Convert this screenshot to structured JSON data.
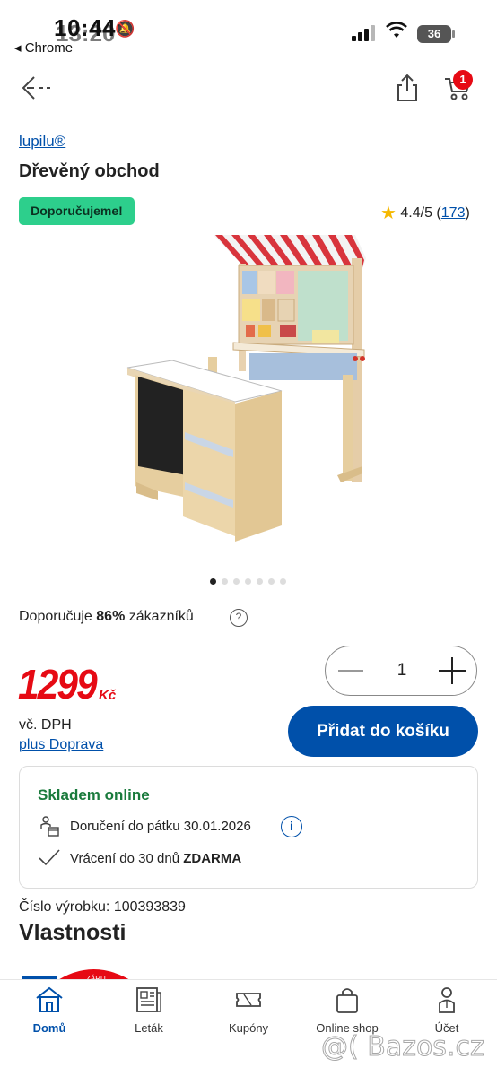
{
  "status_bar": {
    "time": "10:44",
    "time_overlay": "13:20",
    "back_app": "◂ Chrome",
    "battery": "36"
  },
  "header": {
    "cart_count": "1",
    "icons": [
      "back-arrow-icon",
      "share-icon",
      "cart-icon"
    ]
  },
  "product": {
    "brand": "lupilu®",
    "title": "Dřevěný obchod",
    "badge": "Doporučujeme!",
    "rating": "4.4/5",
    "rating_count": "173",
    "gallery_total": 7,
    "gallery_active": 1,
    "recommend_prefix": "Doporučuje",
    "recommend_percent": "86%",
    "recommend_suffix": "zákazníků",
    "quantity": "1",
    "price": "1299",
    "currency": "Kč",
    "vat": "vč. DPH",
    "shipping_link": "plus Doprava",
    "add_to_cart": "Přidat do košíku",
    "sku": "Číslo výrobku: 100393839",
    "section_title": "Vlastnosti"
  },
  "stock": {
    "title": "Skladem online",
    "delivery": "Doručení do pátku 30.01.2026",
    "return_prefix": "Vrácení do 30 dnů",
    "return_bold": "ZDARMA"
  },
  "bottom_nav": [
    {
      "label": "Domů",
      "icon": "home-icon",
      "active": true
    },
    {
      "label": "Leták",
      "icon": "leaflet-icon",
      "active": false
    },
    {
      "label": "Kupóny",
      "icon": "coupon-icon",
      "active": false
    },
    {
      "label": "Online shop",
      "icon": "shopping-bag-icon",
      "active": false
    },
    {
      "label": "Účet",
      "icon": "account-icon",
      "active": false
    }
  ],
  "watermark": "@( Bazos.cz",
  "colors": {
    "brand_blue": "#0050aa",
    "price_red": "#e60a14",
    "badge_green": "#2dcf8c",
    "stock_green": "#1a7a3c"
  }
}
